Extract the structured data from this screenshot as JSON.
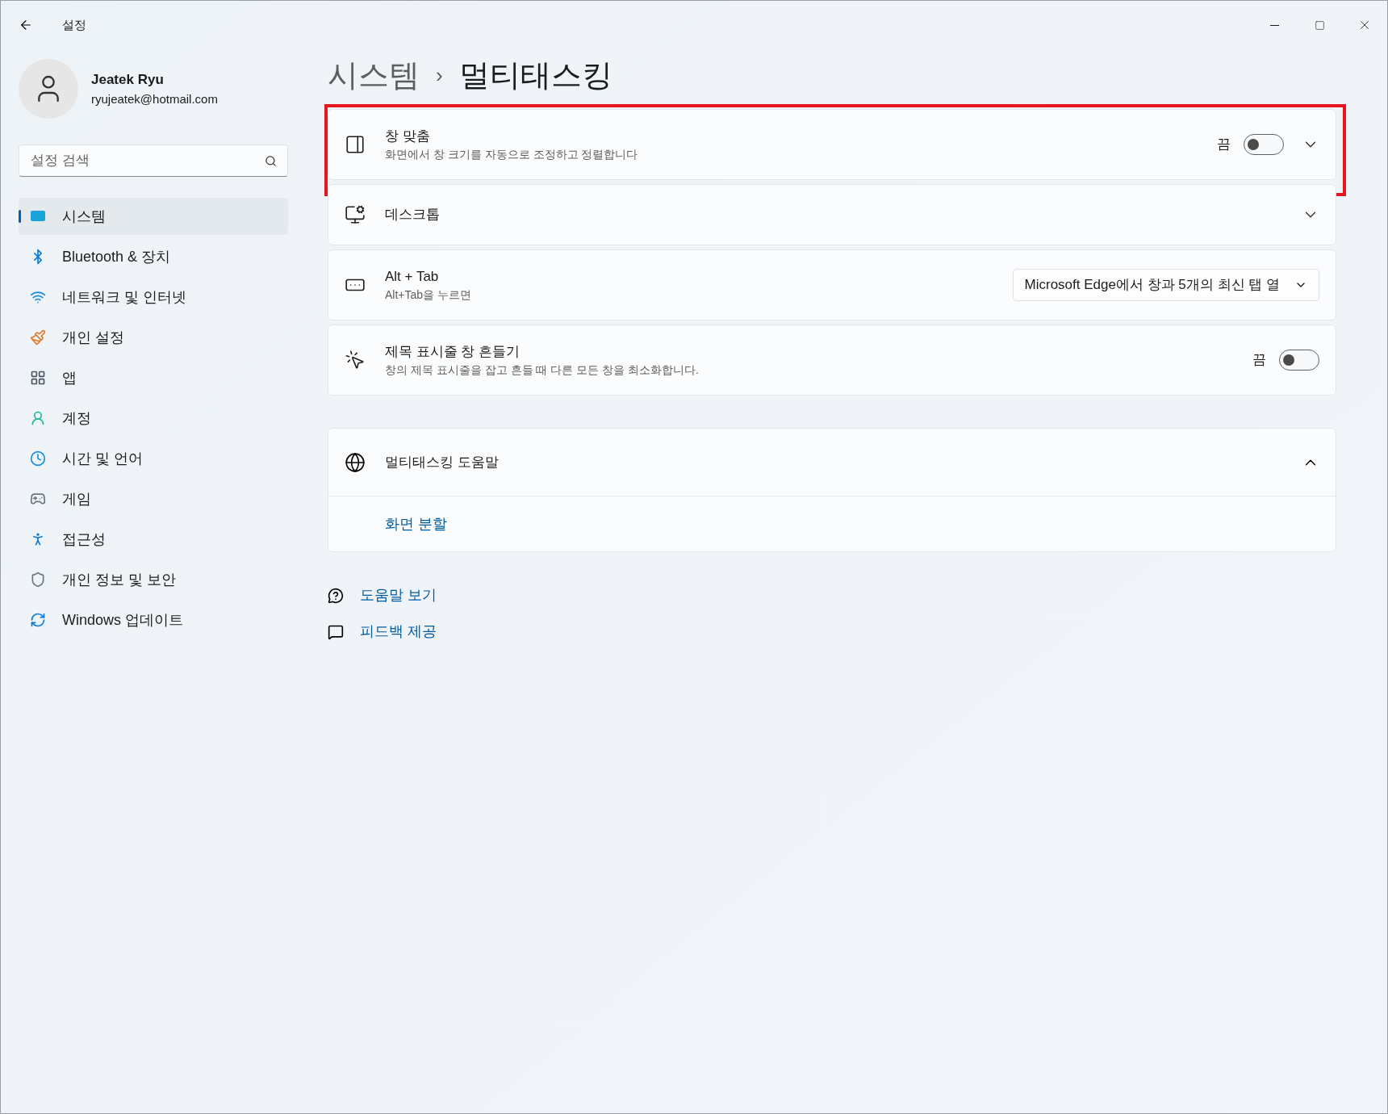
{
  "window": {
    "title": "설정"
  },
  "profile": {
    "name": "Jeatek Ryu",
    "email": "ryujeatek@hotmail.com"
  },
  "search": {
    "placeholder": "설정 검색"
  },
  "sidebar": {
    "items": [
      {
        "label": "시스템",
        "selected": true
      },
      {
        "label": "Bluetooth & 장치",
        "selected": false
      },
      {
        "label": "네트워크 및 인터넷",
        "selected": false
      },
      {
        "label": "개인 설정",
        "selected": false
      },
      {
        "label": "앱",
        "selected": false
      },
      {
        "label": "계정",
        "selected": false
      },
      {
        "label": "시간 및 언어",
        "selected": false
      },
      {
        "label": "게임",
        "selected": false
      },
      {
        "label": "접근성",
        "selected": false
      },
      {
        "label": "개인 정보 및 보안",
        "selected": false
      },
      {
        "label": "Windows 업데이트",
        "selected": false
      }
    ]
  },
  "breadcrumb": {
    "parent": "시스템",
    "separator": "›",
    "current": "멀티태스킹"
  },
  "settings": [
    {
      "kind": "toggle",
      "title": "창 맞춤",
      "description": "화면에서 창 크기를 자동으로 조정하고 정렬합니다",
      "state_label": "끔",
      "on": false,
      "expandable": true,
      "highlighted": true
    },
    {
      "kind": "expander",
      "title": "데스크톱",
      "expandable": true,
      "highlighted": false
    },
    {
      "kind": "dropdown",
      "title": "Alt + Tab",
      "description": "Alt+Tab을 누르면",
      "value": "Microsoft Edge에서 창과 5개의 최신 탭 열",
      "highlighted": false
    },
    {
      "kind": "toggle",
      "title": "제목 표시줄 창 흔들기",
      "description": "창의 제목 표시줄을 잡고 흔들 때 다른 모든 창을 최소화합니다.",
      "state_label": "끔",
      "on": false,
      "expandable": false,
      "highlighted": false
    }
  ],
  "help": {
    "title": "멀티태스킹 도움말",
    "expanded": true,
    "links": [
      "화면 분할"
    ]
  },
  "footer_links": [
    {
      "label": "도움말 보기"
    },
    {
      "label": "피드백 제공"
    }
  ]
}
